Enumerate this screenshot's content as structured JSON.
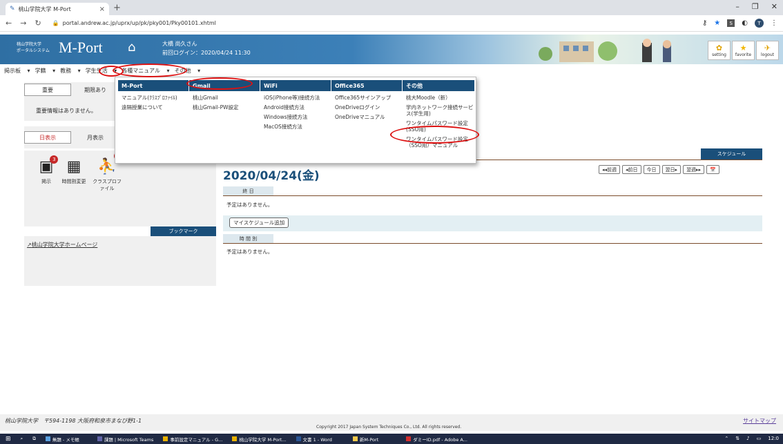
{
  "browser": {
    "tab_title": "桃山学院大学 M-Port",
    "url": "portal.andrew.ac.jp/uprx/up/pk/pky001/Pky00101.xhtml",
    "profile_initial": "T",
    "minimize": "–",
    "maximize": "❐",
    "close": "✕"
  },
  "header": {
    "logo_small_line1": "桃山学院大学",
    "logo_small_line2": "ポータルシステム",
    "logo_big": "M-Port",
    "user_name": "大橋 尚久さん",
    "last_login": "前回ログイン：2020/04/24 11:30",
    "buttons": [
      {
        "label": "setting",
        "icon": "gear-icon"
      },
      {
        "label": "favorite",
        "icon": "star-icon"
      },
      {
        "label": "logout",
        "icon": "running-person-icon"
      }
    ]
  },
  "nav": [
    "掲示板",
    "学籍",
    "教務",
    "学生生活",
    "各種マニュアル",
    "その他"
  ],
  "left": {
    "tab_important": "重要",
    "tab_deadline": "期限あり",
    "no_important": "重要情報はありません。",
    "tab_day": "日表示",
    "tab_month": "月表示",
    "icons": [
      {
        "label": "掲示",
        "badge": "3",
        "icon": "bulletin-icon"
      },
      {
        "label": "時間割変更",
        "badge": "",
        "icon": "timetable-change-icon"
      },
      {
        "label": "クラスプロファイル",
        "badge": "",
        "icon": "class-profile-icon"
      }
    ],
    "bookmark_header": "ブックマーク",
    "bookmark_link": "桃山学院大学ホームページ"
  },
  "main": {
    "schedule_header": "スケジュール",
    "date": "2020/04/24(金)",
    "nav_buttons": [
      "◂◂前週",
      "◂前日",
      "今日",
      "翌日▸",
      "翌週▸▸",
      "📅"
    ],
    "allday_label": "終 日",
    "no_schedule": "予定はありません。",
    "add_button": "マイスケジュール追加",
    "timed_label": "時 間 別",
    "no_schedule2": "予定はありません。"
  },
  "dropdown": {
    "columns": [
      {
        "header": "M-Port",
        "items": [
          "マニュアル(ｸﾗｽﾌﾟﾛﾌｧｲﾙ)",
          "遠隔授業について"
        ]
      },
      {
        "header": "Gmail",
        "items": [
          "桃山Gmail",
          "桃山Gmail-PW設定"
        ]
      },
      {
        "header": "WiFi",
        "items": [
          "iOS(iPhone等)接続方法",
          "Android接続方法",
          "Windows接続方法",
          "MacOS接続方法"
        ]
      },
      {
        "header": "Office365",
        "items": [
          "Office365サインアップ",
          "OneDriveログイン",
          "OneDriveマニュアル"
        ]
      },
      {
        "header": "その他",
        "items": [
          "桃大Moodle（新）",
          "学内ネットワーク接続サービス(学生用)",
          "ワンタイムパスワード設定(SSO用)",
          "ワンタイムパスワード設定（SSO用）マニュアル"
        ]
      }
    ]
  },
  "footer": {
    "address": "桃山学院大学　〒594-1198 大阪府和泉市まなび野1-1",
    "sitemap": "サイトマップ",
    "copyright": "Copyright 2017 Japan System Techniques Co., Ltd. All rights reserved."
  },
  "taskbar": {
    "items": [
      "無題 - メモ帳",
      "課題 | Microsoft Teams",
      "事前設定マニュアル - G...",
      "桃山学院大学 M-Port...",
      "文書 1 - Word",
      "新M-Port",
      "ダミーID.pdf - Adobe A..."
    ],
    "clock": "12:0"
  }
}
